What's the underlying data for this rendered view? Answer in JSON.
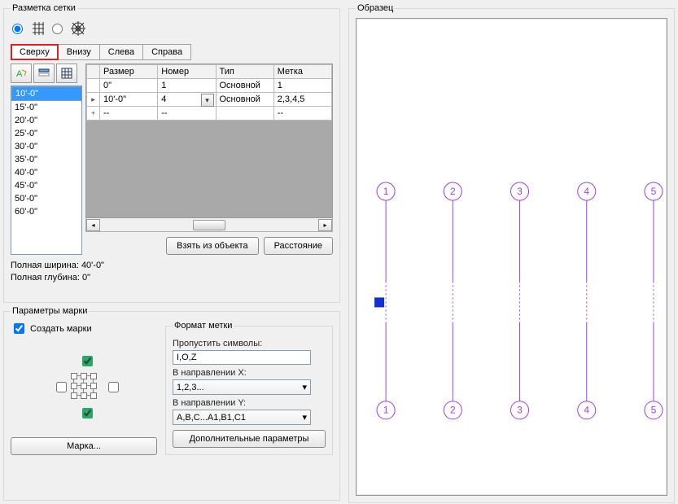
{
  "grid_markup": {
    "legend": "Разметка сетки",
    "tabs": [
      "Сверху",
      "Внизу",
      "Слева",
      "Справа"
    ],
    "active_tab": 0,
    "size_list": [
      "10'-0\"",
      "15'-0\"",
      "20'-0\"",
      "25'-0\"",
      "30'-0\"",
      "35'-0\"",
      "40'-0\"",
      "45'-0\"",
      "50'-0\"",
      "60'-0\""
    ],
    "selected_size_index": 0,
    "table": {
      "headers": [
        "Размер",
        "Номер",
        "Тип",
        "Метка"
      ],
      "rows": [
        {
          "size": "0\"",
          "number": "1",
          "type": "Основной",
          "label": "1"
        },
        {
          "size": "10'-0\"",
          "number": "4",
          "type": "Основной",
          "label": "2,3,4,5",
          "editing": true
        },
        {
          "size": "--",
          "number": "--",
          "type": "",
          "label": "--"
        }
      ]
    },
    "buttons": {
      "from_object": "Взять из объекта",
      "distance": "Расстояние"
    },
    "info": {
      "full_width": "Полная ширина: 40'-0\"",
      "full_depth": "Полная глубина: 0\""
    }
  },
  "marks": {
    "legend": "Параметры марки",
    "create_marks": "Создать марки",
    "create_marks_checked": true,
    "checkboxes": {
      "top": true,
      "bottom": true,
      "left": false,
      "right": false
    },
    "mark_button": "Марка...",
    "format": {
      "legend": "Формат метки",
      "skip_label": "Пропустить символы:",
      "skip_value": "I,O,Z",
      "dir_x_label": "В направлении X:",
      "dir_x_value": "1,2,3...",
      "dir_y_label": "В направлении Y:",
      "dir_y_value": "A,B,C...A1,B1,C1",
      "extra_button": "Дополнительные параметры"
    }
  },
  "preview": {
    "legend": "Образец",
    "top_labels": [
      "1",
      "2",
      "3",
      "4",
      "5"
    ],
    "bottom_labels": [
      "1",
      "2",
      "3",
      "4",
      "5"
    ]
  }
}
